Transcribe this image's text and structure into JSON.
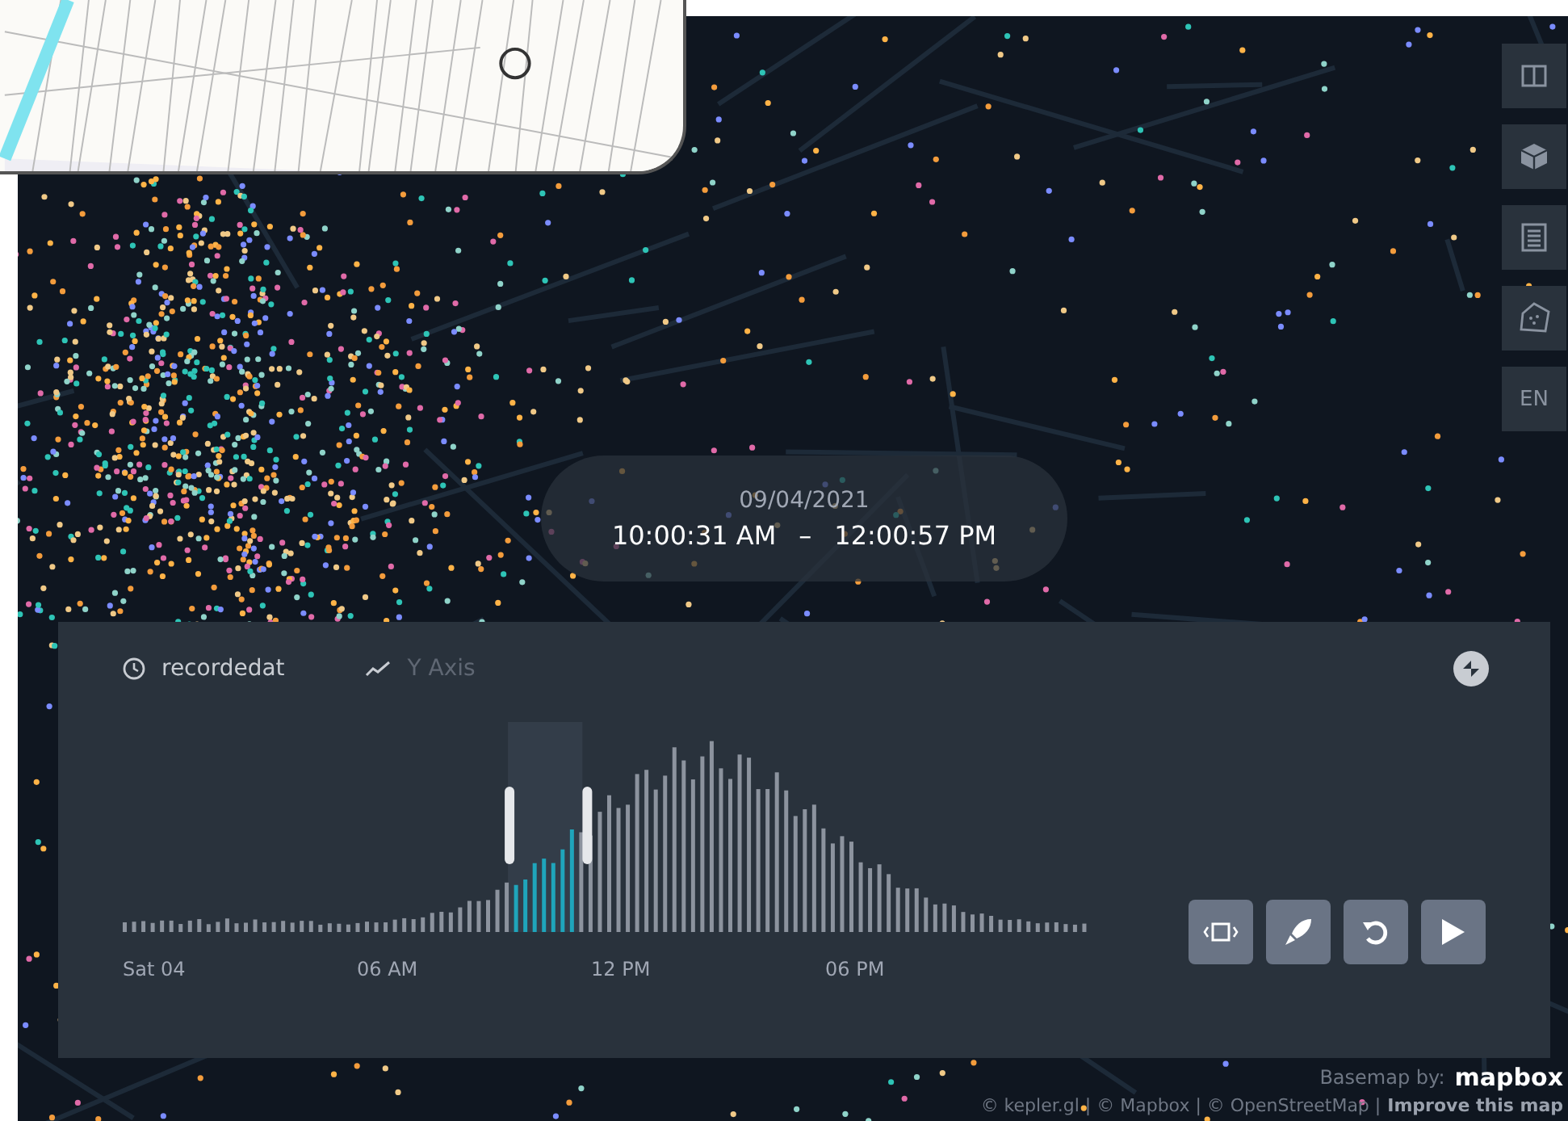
{
  "time_display": {
    "date": "09/04/2021",
    "start": "10:00:31 AM",
    "separator": "–",
    "end": "12:00:57 PM"
  },
  "map_controls": [
    {
      "kind": "split"
    },
    {
      "kind": "cube"
    },
    {
      "kind": "legend"
    },
    {
      "kind": "draw"
    },
    {
      "kind": "text",
      "label": "EN"
    }
  ],
  "timeline": {
    "field": "recordedat",
    "y_axis": {
      "label": "Y Axis",
      "disabled": true
    },
    "xticks": [
      "Sat 04",
      "06 AM",
      "12 PM",
      "06 PM"
    ],
    "buttons": [
      {
        "kind": "frame"
      },
      {
        "kind": "speed"
      },
      {
        "kind": "reset"
      },
      {
        "kind": "play"
      }
    ]
  },
  "attribution": {
    "basemap": "Basemap by:",
    "logo": "mapbox",
    "credits": "© kepler.gl | © Mapbox | © OpenStreetMap |",
    "improve": "Improve this map"
  }
}
